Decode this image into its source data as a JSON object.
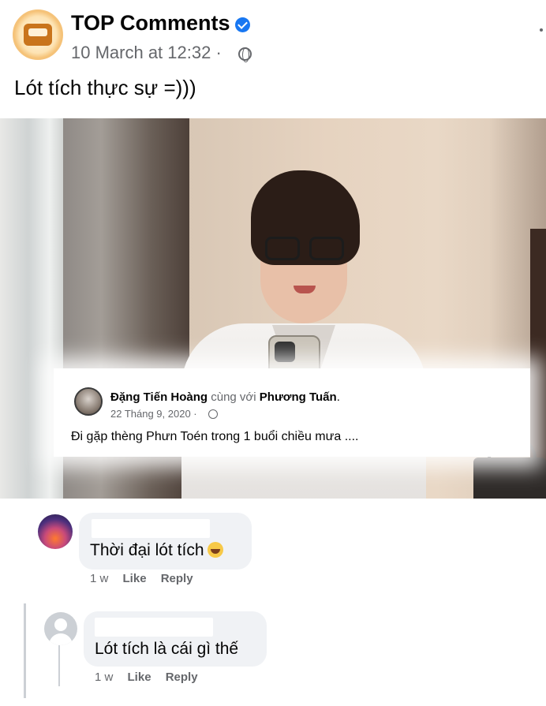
{
  "post": {
    "page_name": "TOP Comments",
    "time": "10 March at 12:32 ·",
    "text": "Lót tích thực sự =)))"
  },
  "embedded_post": {
    "author": "Đặng Tiến Hoàng",
    "with_text": "cùng với",
    "tagged": "Phương Tuấn",
    "period": ".",
    "date": "22 Tháng 9, 2020 ·",
    "text": "Đi gặp thèng Phưn Toén trong 1 buổi chiều mưa ...."
  },
  "comments": [
    {
      "text": "Thời đại lót tích",
      "time": "1 w",
      "like_label": "Like",
      "reply_label": "Reply"
    },
    {
      "text": "Lót tích là cái gì thế",
      "time": "1 w",
      "like_label": "Like",
      "reply_label": "Reply"
    }
  ],
  "icons": {
    "verified": "verified-badge-icon",
    "privacy": "globe-icon",
    "more": "more-options-icon",
    "emoji": "rolling-laughing-emoji"
  },
  "colors": {
    "accent": "#1877f2",
    "muted_text": "#65676b",
    "bubble": "#f0f2f5"
  }
}
